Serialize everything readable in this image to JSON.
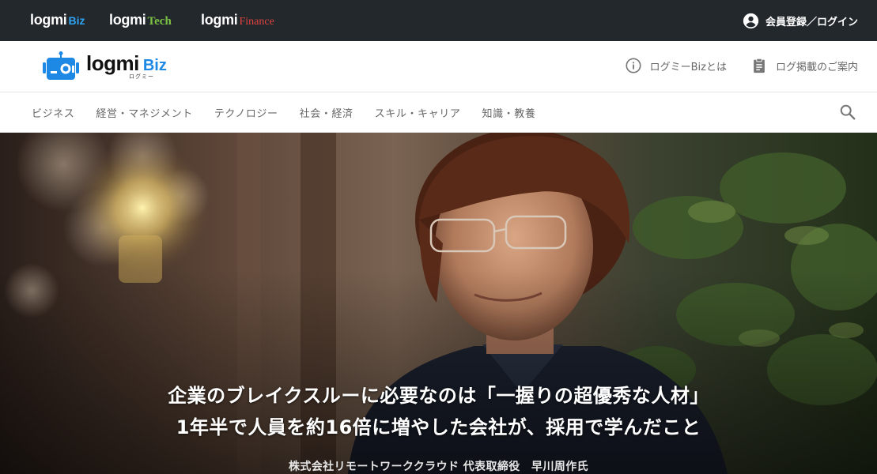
{
  "network_bar": {
    "brands": [
      {
        "base": "logmi",
        "suffix": "Biz"
      },
      {
        "base": "logmi",
        "suffix": "Tech"
      },
      {
        "base": "logmi",
        "suffix": "Finance"
      }
    ],
    "login_label": "会員登録／ログイン",
    "login_icon": "account-circle-icon"
  },
  "header": {
    "logo": {
      "main": "logmi",
      "accent": "Biz",
      "ruby": "ログミー"
    },
    "links": [
      {
        "label": "ログミーBizとは",
        "icon": "info-icon"
      },
      {
        "label": "ログ掲載のご案内",
        "icon": "clipboard-icon"
      }
    ]
  },
  "category_nav": {
    "items": [
      "ビジネス",
      "経営・マネジメント",
      "テクノロジー",
      "社会・経済",
      "スキル・キャリア",
      "知識・教養"
    ],
    "search_icon": "search-icon"
  },
  "hero": {
    "title_line1": "企業のブレイクスルーに必要なのは「一握りの超優秀な人材」",
    "title_line2": "1年半で人員を約16倍に増やした会社が、採用で学んだこと",
    "speaker": "株式会社リモートワーククラウド 代表取締役　早川周作氏"
  },
  "colors": {
    "network_bar_bg": "#23282d",
    "biz_accent": "#2ea3f2",
    "tech_accent": "#7cc243",
    "finance_accent": "#e0433f",
    "logo_blue": "#1e88e5"
  }
}
